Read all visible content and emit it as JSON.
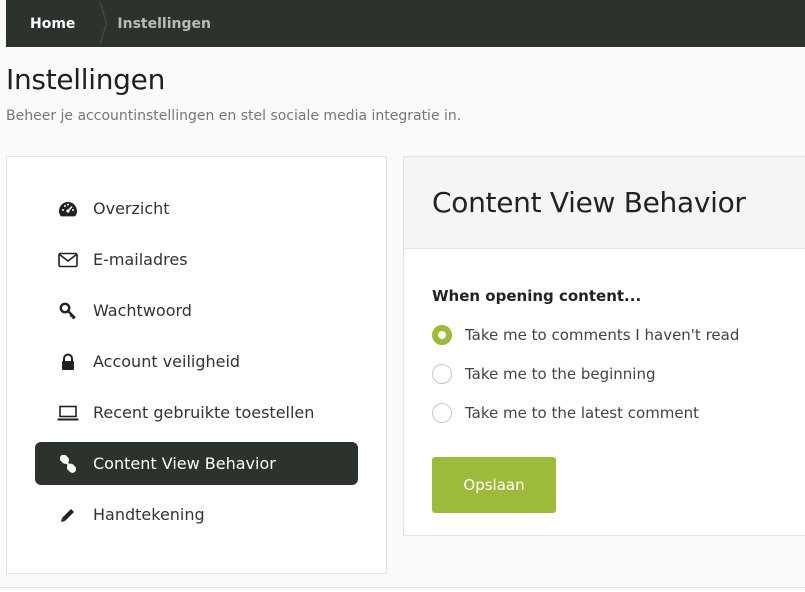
{
  "breadcrumb": {
    "home": "Home",
    "current": "Instellingen"
  },
  "page": {
    "title": "Instellingen",
    "subtitle": "Beheer je accountinstellingen en stel sociale media integratie in."
  },
  "sidebar": {
    "items": [
      {
        "label": "Overzicht",
        "icon": "dashboard-icon"
      },
      {
        "label": "E-mailadres",
        "icon": "envelope-icon"
      },
      {
        "label": "Wachtwoord",
        "icon": "key-icon"
      },
      {
        "label": "Account veiligheid",
        "icon": "lock-icon"
      },
      {
        "label": "Recent gebruikte toestellen",
        "icon": "laptop-icon"
      },
      {
        "label": "Content View Behavior",
        "icon": "link-icon",
        "active": true
      },
      {
        "label": "Handtekening",
        "icon": "pencil-icon"
      }
    ]
  },
  "panel": {
    "title": "Content View Behavior",
    "section_label": "When opening content...",
    "options": [
      {
        "label": "Take me to comments I haven't read",
        "checked": true
      },
      {
        "label": "Take me to the beginning",
        "checked": false
      },
      {
        "label": "Take me to the latest comment",
        "checked": false
      }
    ],
    "save_label": "Opslaan"
  },
  "colors": {
    "dark": "#2c332d",
    "accent": "#9dba3a"
  }
}
